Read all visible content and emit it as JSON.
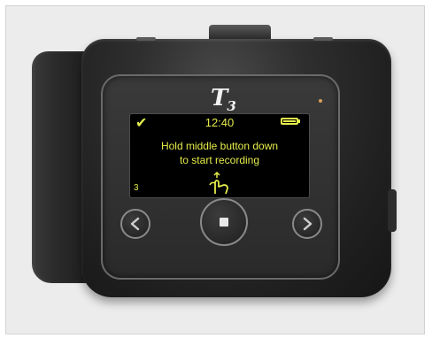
{
  "device": {
    "brand": {
      "logo_letter": "T",
      "logo_sub": "3"
    },
    "screen": {
      "time": "12:40",
      "message_line1": "Hold middle button down",
      "message_line2": "to start recording",
      "counter": "3",
      "status_icon": "check-icon",
      "battery_icon": "battery-icon",
      "hint_icon": "press-hand-icon"
    },
    "buttons": {
      "prev_icon": "chevron-left-icon",
      "record_icon": "stop-square-icon",
      "next_icon": "chevron-right-icon"
    },
    "colors": {
      "display_text": "#e4ec4a",
      "body": "#2a2a2a",
      "background": "#ececec"
    }
  }
}
